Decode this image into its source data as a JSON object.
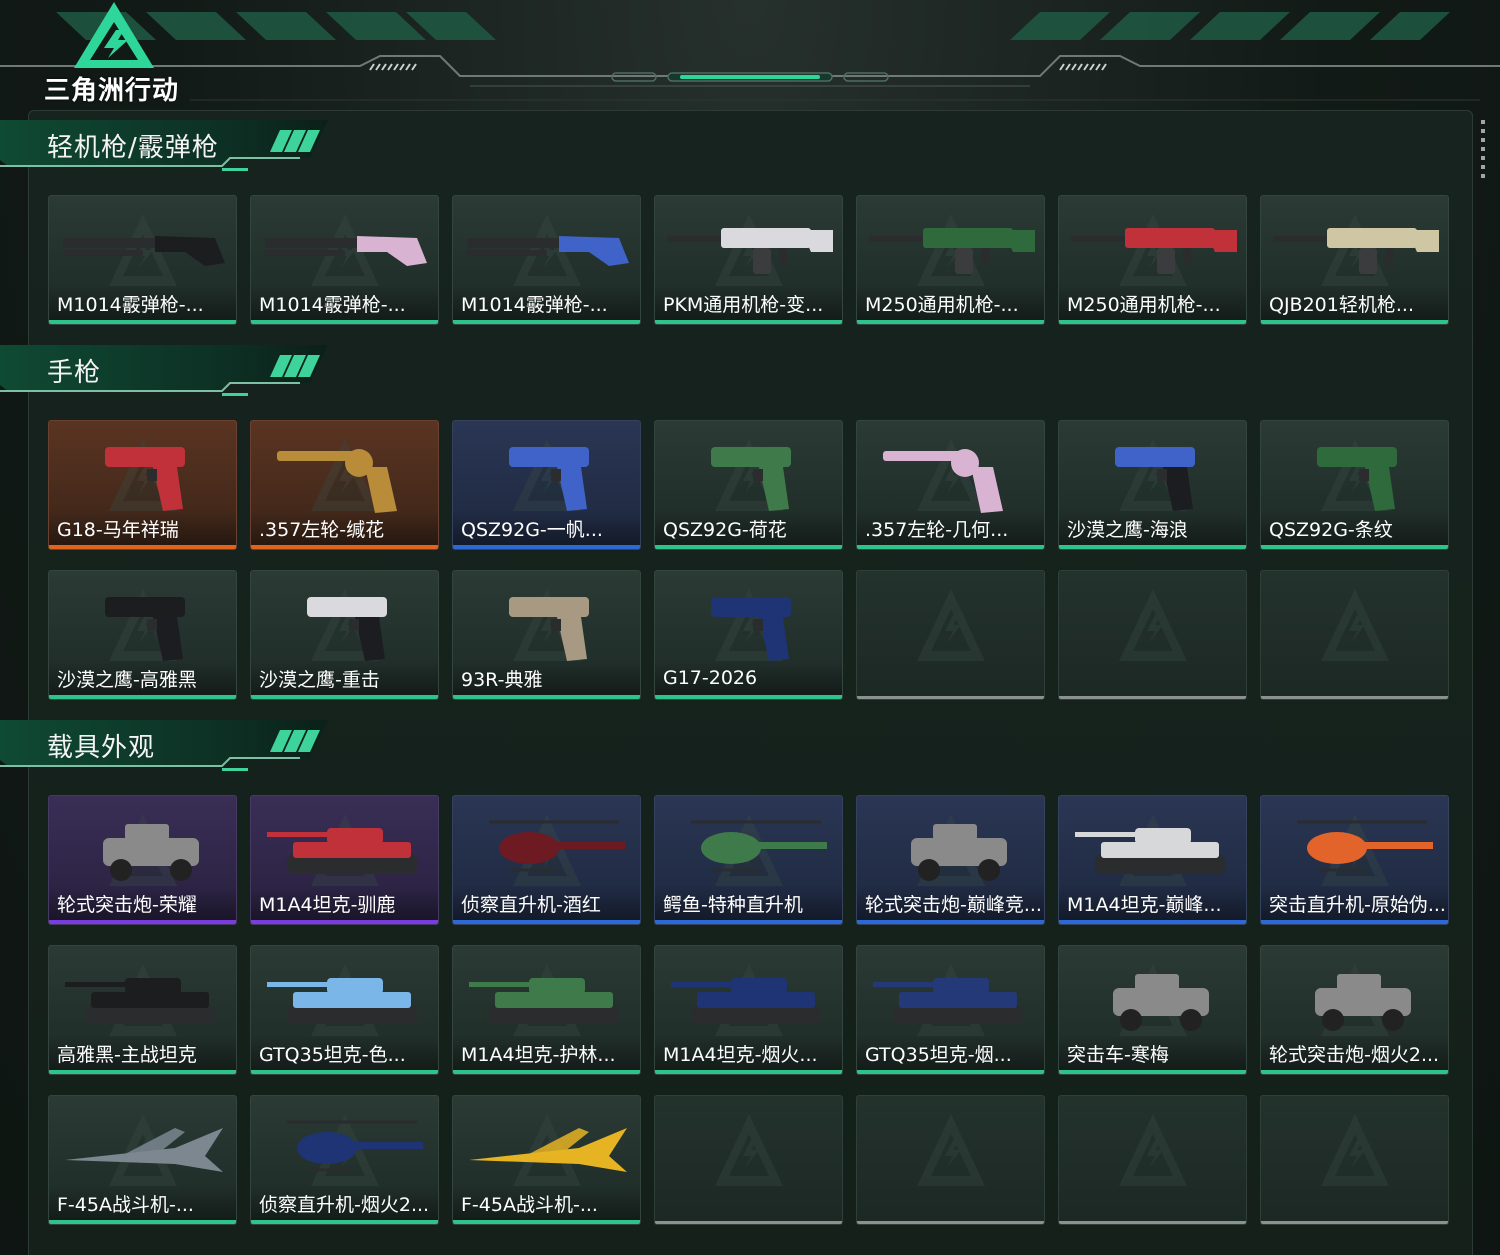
{
  "app": {
    "logo_text": "三角洲行动"
  },
  "sections": [
    {
      "title": "轻机枪/霰弹枪",
      "items": [
        {
          "label": "M1014霰弹枪-...",
          "rarity": "green",
          "icon": "shotgun-black"
        },
        {
          "label": "M1014霰弹枪-...",
          "rarity": "green",
          "icon": "shotgun-pink"
        },
        {
          "label": "M1014霰弹枪-...",
          "rarity": "green",
          "icon": "shotgun-blue"
        },
        {
          "label": "PKM通用机枪-变...",
          "rarity": "green",
          "icon": "machinegun-white"
        },
        {
          "label": "M250通用机枪-...",
          "rarity": "green",
          "icon": "machinegun-green"
        },
        {
          "label": "M250通用机枪-...",
          "rarity": "green",
          "icon": "machinegun-red"
        },
        {
          "label": "QJB201轻机枪...",
          "rarity": "green",
          "icon": "lmg-beige"
        }
      ]
    },
    {
      "title": "手枪",
      "items": [
        {
          "label": "G18-马年祥瑞",
          "rarity": "orange",
          "icon": "pistol-red"
        },
        {
          "label": ".357左轮-缄花",
          "rarity": "orange",
          "icon": "revolver-gold"
        },
        {
          "label": "QSZ92G-一帆...",
          "rarity": "blue",
          "icon": "pistol-blue"
        },
        {
          "label": "QSZ92G-荷花",
          "rarity": "green",
          "icon": "pistol-camo"
        },
        {
          "label": ".357左轮-几何...",
          "rarity": "green",
          "icon": "revolver-pink"
        },
        {
          "label": "沙漠之鹰-海浪",
          "rarity": "green",
          "icon": "deagle-blue"
        },
        {
          "label": "QSZ92G-条纹",
          "rarity": "green",
          "icon": "pistol-green"
        },
        {
          "label": "沙漠之鹰-高雅黑",
          "rarity": "green",
          "icon": "deagle-black"
        },
        {
          "label": "沙漠之鹰-重击",
          "rarity": "green",
          "icon": "deagle-white"
        },
        {
          "label": "93R-典雅",
          "rarity": "green",
          "icon": "pistol-tan"
        },
        {
          "label": "G17-2026",
          "rarity": "green",
          "icon": "pistol-navy"
        },
        {
          "empty": true
        },
        {
          "empty": true
        },
        {
          "empty": true
        }
      ]
    },
    {
      "title": "载具外观",
      "items": [
        {
          "label": "轮式突击炮-荣耀",
          "rarity": "purple",
          "icon": "armored-car-silver"
        },
        {
          "label": "M1A4坦克-驯鹿",
          "rarity": "purple",
          "icon": "tank-red"
        },
        {
          "label": "侦察直升机-酒红",
          "rarity": "blue",
          "icon": "helicopter-wine"
        },
        {
          "label": "鳄鱼-特种直升机",
          "rarity": "blue",
          "icon": "helicopter-camo"
        },
        {
          "label": "轮式突击炮-巅峰竞...",
          "rarity": "blue",
          "icon": "armored-car-red"
        },
        {
          "label": "M1A4坦克-巅峰...",
          "rarity": "blue",
          "icon": "tank-redwhite"
        },
        {
          "label": "突击直升机-原始伪...",
          "rarity": "blue",
          "icon": "helicopter-orange"
        },
        {
          "label": "高雅黑-主战坦克",
          "rarity": "green",
          "icon": "tank-black"
        },
        {
          "label": "GTQ35坦克-色...",
          "rarity": "green",
          "icon": "tank-lightblue"
        },
        {
          "label": "M1A4坦克-护林...",
          "rarity": "green",
          "icon": "tank-camo"
        },
        {
          "label": "M1A4坦克-烟火...",
          "rarity": "green",
          "icon": "tank-navy"
        },
        {
          "label": "GTQ35坦克-烟...",
          "rarity": "green",
          "icon": "tank-navy2"
        },
        {
          "label": "突击车-寒梅",
          "rarity": "green",
          "icon": "armored-car-white"
        },
        {
          "label": "轮式突击炮-烟火2...",
          "rarity": "green",
          "icon": "armored-car-navy"
        },
        {
          "label": "F-45A战斗机-...",
          "rarity": "green",
          "icon": "jet-gray"
        },
        {
          "label": "侦察直升机-烟火2...",
          "rarity": "green",
          "icon": "helicopter-navy"
        },
        {
          "label": "F-45A战斗机-...",
          "rarity": "green",
          "icon": "jet-yellow"
        },
        {
          "empty": true
        },
        {
          "empty": true
        },
        {
          "empty": true
        },
        {
          "empty": true
        }
      ]
    }
  ],
  "colors": {
    "green": "#2cc48a",
    "orange": "#e0641e",
    "blue": "#2b6ad6",
    "purple": "#7a3cdc",
    "empty": "#8a918e"
  }
}
